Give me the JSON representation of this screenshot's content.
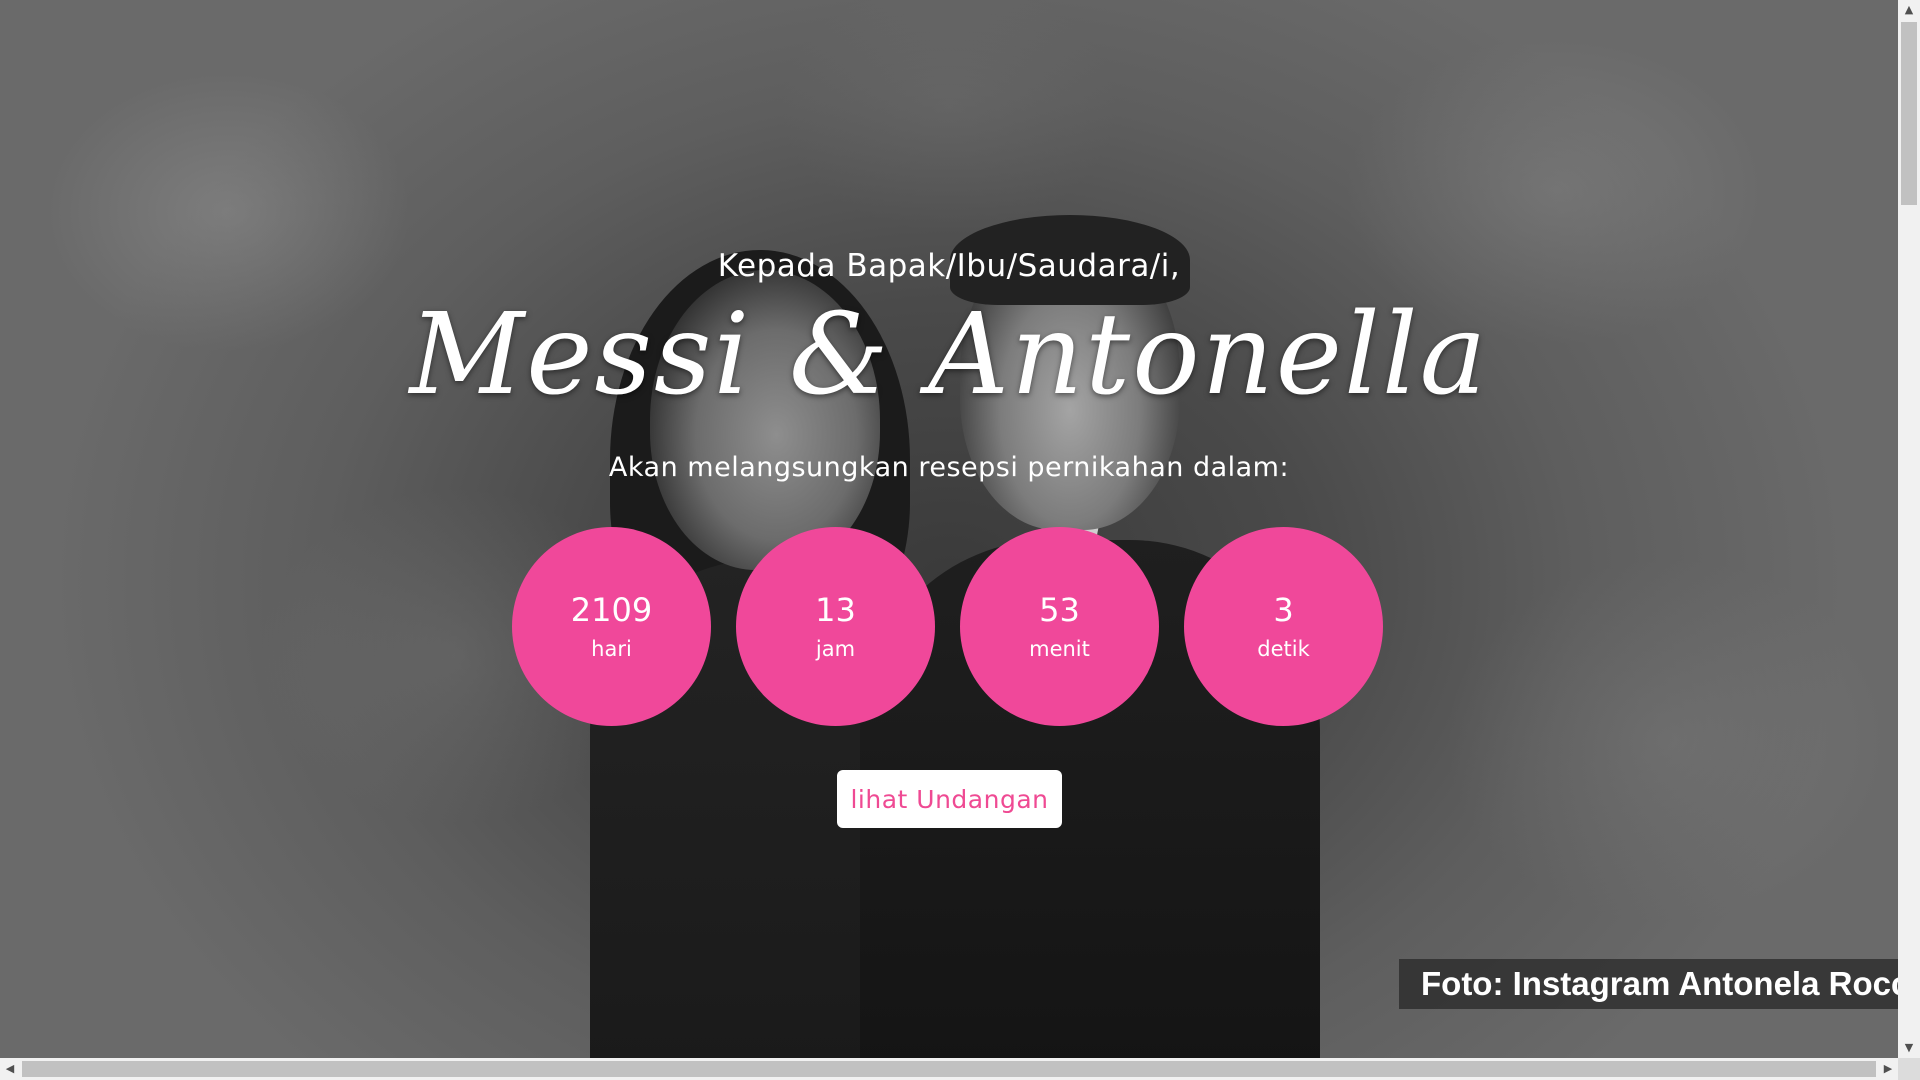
{
  "invitation": {
    "greeting": "Kepada Bapak/Ibu/Saudara/i,",
    "couple_names": "Messi & Antonella",
    "subtitle": "Akan melangsungkan resepsi pernikahan dalam:",
    "countdown": [
      {
        "value": "2109",
        "unit": "hari"
      },
      {
        "value": "13",
        "unit": "jam"
      },
      {
        "value": "53",
        "unit": "menit"
      },
      {
        "value": "3",
        "unit": "detik"
      }
    ],
    "cta_label": "lihat Undangan",
    "photo_caption": "Foto: Instagram Antonela Roccuzzo"
  },
  "colors": {
    "accent": "#f0489a",
    "button_text": "#ef4a93",
    "text": "#ffffff"
  },
  "icons": {
    "scroll_up": "triangle-up-icon",
    "scroll_down": "triangle-down-icon",
    "scroll_left": "triangle-left-icon",
    "scroll_right": "triangle-right-icon"
  }
}
